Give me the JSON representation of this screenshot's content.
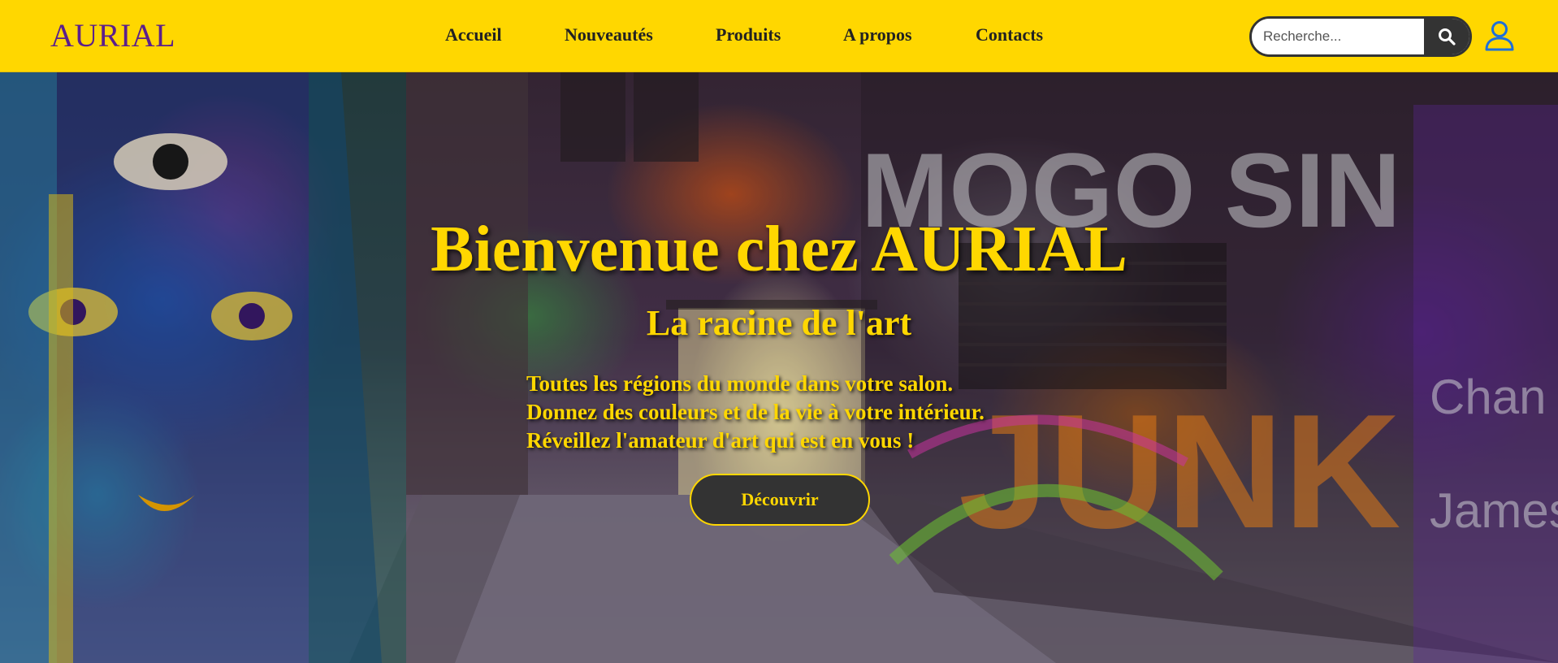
{
  "header": {
    "logo": "AURIAL",
    "nav": [
      {
        "label": "Accueil"
      },
      {
        "label": "Nouveautés"
      },
      {
        "label": "Produits"
      },
      {
        "label": "A propos"
      },
      {
        "label": "Contacts"
      }
    ],
    "search": {
      "placeholder": "Recherche...",
      "value": "",
      "button_icon": "search-icon"
    },
    "user_icon": "user-icon"
  },
  "hero": {
    "title": "Bienvenue chez AURIAL",
    "subtitle": "La racine de l'art",
    "lines": [
      "Toutes les régions du monde dans votre salon.",
      "Donnez des couleurs et de la vie à votre intérieur.",
      "Réveillez l'amateur d'art qui est en vous !"
    ],
    "cta_label": "Découvrir"
  },
  "colors": {
    "header_bg": "#ffd700",
    "logo": "#5b1f8c",
    "hero_text": "#ffd700",
    "button_bg": "#333333",
    "user_icon": "#1e6fd9"
  }
}
